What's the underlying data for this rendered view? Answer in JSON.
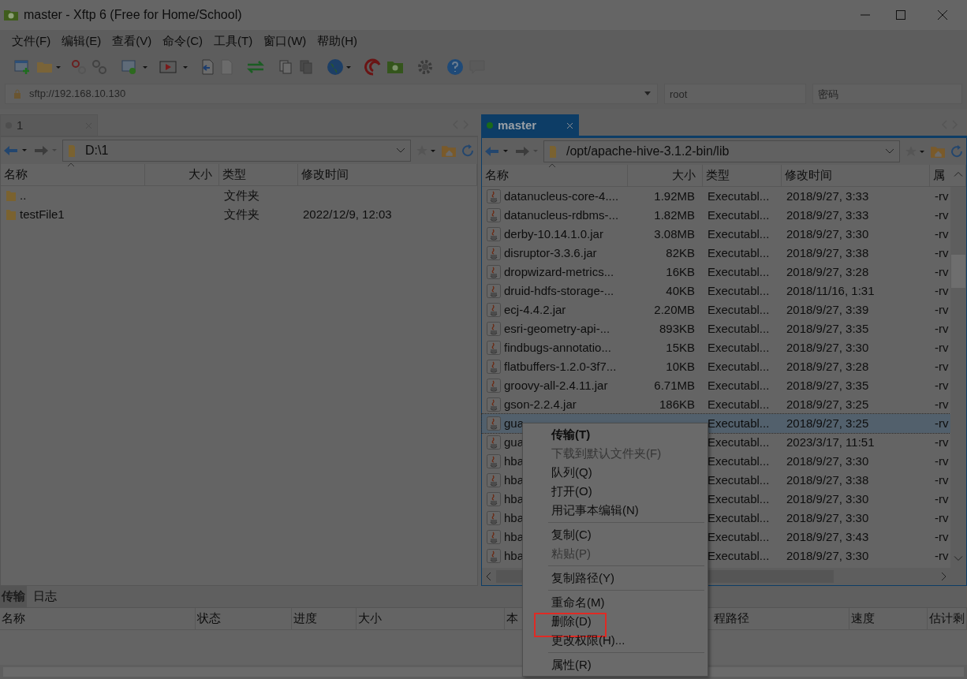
{
  "window": {
    "title": "master - Xftp 6 (Free for Home/School)"
  },
  "menu_bar": [
    "文件(F)",
    "编辑(E)",
    "查看(V)",
    "命令(C)",
    "工具(T)",
    "窗口(W)",
    "帮助(H)"
  ],
  "address_bar": {
    "host_placeholder": "sftp://192.168.10.130",
    "user_placeholder": "root",
    "password_placeholder": "密码"
  },
  "local_pane": {
    "tabs": [
      {
        "label": "1",
        "selected": false,
        "connected": false
      }
    ],
    "path": "D:\\1",
    "columns": [
      "名称",
      "大小",
      "类型",
      "修改时间"
    ],
    "rows": [
      {
        "kind": "folder",
        "name": "..",
        "type": "文件夹",
        "selected": false
      },
      {
        "kind": "folder",
        "name": "testFile1",
        "type": "文件夹",
        "modified": "2022/12/9, 12:03",
        "selected": false
      }
    ]
  },
  "remote_pane": {
    "tabs": [
      {
        "label": "master",
        "selected": true,
        "connected": true
      }
    ],
    "path": "/opt/apache-hive-3.1.2-bin/lib",
    "columns": [
      "名称",
      "大小",
      "类型",
      "修改时间",
      "属"
    ],
    "rows": [
      {
        "kind": "jar",
        "name": "datanucleus-core-4....",
        "size": "1.92MB",
        "type": "Executabl...",
        "modified": "2018/9/27, 3:33",
        "attr": "-rv",
        "selected": false
      },
      {
        "kind": "jar",
        "name": "datanucleus-rdbms-...",
        "size": "1.82MB",
        "type": "Executabl...",
        "modified": "2018/9/27, 3:33",
        "attr": "-rv",
        "selected": false
      },
      {
        "kind": "jar",
        "name": "derby-10.14.1.0.jar",
        "size": "3.08MB",
        "type": "Executabl...",
        "modified": "2018/9/27, 3:30",
        "attr": "-rv",
        "selected": false
      },
      {
        "kind": "jar",
        "name": "disruptor-3.3.6.jar",
        "size": "82KB",
        "type": "Executabl...",
        "modified": "2018/9/27, 3:38",
        "attr": "-rv",
        "selected": false
      },
      {
        "kind": "jar",
        "name": "dropwizard-metrics...",
        "size": "16KB",
        "type": "Executabl...",
        "modified": "2018/9/27, 3:28",
        "attr": "-rv",
        "selected": false
      },
      {
        "kind": "jar",
        "name": "druid-hdfs-storage-...",
        "size": "40KB",
        "type": "Executabl...",
        "modified": "2018/11/16, 1:31",
        "attr": "-rv",
        "selected": false
      },
      {
        "kind": "jar",
        "name": "ecj-4.4.2.jar",
        "size": "2.20MB",
        "type": "Executabl...",
        "modified": "2018/9/27, 3:39",
        "attr": "-rv",
        "selected": false
      },
      {
        "kind": "jar",
        "name": "esri-geometry-api-...",
        "size": "893KB",
        "type": "Executabl...",
        "modified": "2018/9/27, 3:35",
        "attr": "-rv",
        "selected": false
      },
      {
        "kind": "jar",
        "name": "findbugs-annotatio...",
        "size": "15KB",
        "type": "Executabl...",
        "modified": "2018/9/27, 3:30",
        "attr": "-rv",
        "selected": false
      },
      {
        "kind": "jar",
        "name": "flatbuffers-1.2.0-3f7...",
        "size": "10KB",
        "type": "Executabl...",
        "modified": "2018/9/27, 3:28",
        "attr": "-rv",
        "selected": false
      },
      {
        "kind": "jar",
        "name": "groovy-all-2.4.11.jar",
        "size": "6.71MB",
        "type": "Executabl...",
        "modified": "2018/9/27, 3:35",
        "attr": "-rv",
        "selected": false
      },
      {
        "kind": "jar",
        "name": "gson-2.2.4.jar",
        "size": "186KB",
        "type": "Executabl...",
        "modified": "2018/9/27, 3:25",
        "attr": "-rv",
        "selected": false
      },
      {
        "kind": "jar",
        "name": "gua",
        "type": "Executabl...",
        "modified": "2018/9/27, 3:25",
        "attr": "-rv",
        "selected": true
      },
      {
        "kind": "jar",
        "name": "gua",
        "type": "Executabl...",
        "modified": "2023/3/17, 11:51",
        "attr": "-rv",
        "selected": false
      },
      {
        "kind": "jar",
        "name": "hba",
        "type": "Executabl...",
        "modified": "2018/9/27, 3:30",
        "attr": "-rv",
        "selected": false
      },
      {
        "kind": "jar",
        "name": "hba",
        "type": "Executabl...",
        "modified": "2018/9/27, 3:38",
        "attr": "-rv",
        "selected": false
      },
      {
        "kind": "jar",
        "name": "hba",
        "type": "Executabl...",
        "modified": "2018/9/27, 3:30",
        "attr": "-rv",
        "selected": false
      },
      {
        "kind": "jar",
        "name": "hba",
        "type": "Executabl...",
        "modified": "2018/9/27, 3:30",
        "attr": "-rv",
        "selected": false
      },
      {
        "kind": "jar",
        "name": "hba",
        "type": "Executabl...",
        "modified": "2018/9/27, 3:43",
        "attr": "-rv",
        "selected": false
      },
      {
        "kind": "jar",
        "name": "hba",
        "type": "Executabl...",
        "modified": "2018/9/27, 3:30",
        "attr": "-rv",
        "selected": false
      }
    ]
  },
  "transfer_panel": {
    "tabs": [
      {
        "label": "传输",
        "selected": true
      },
      {
        "label": "日志",
        "selected": false
      }
    ],
    "columns": [
      "名称",
      "状态",
      "进度",
      "大小",
      "本",
      "程路径",
      "速度",
      "估计剩"
    ]
  },
  "context_menu": {
    "items": [
      {
        "kind": "item",
        "label": "传输(T)",
        "bold": true,
        "disabled": false,
        "highlighted": false
      },
      {
        "kind": "item",
        "label": "下载到默认文件夹(F)",
        "bold": false,
        "disabled": true,
        "highlighted": false
      },
      {
        "kind": "item",
        "label": "队列(Q)",
        "bold": false,
        "disabled": false,
        "highlighted": false
      },
      {
        "kind": "item",
        "label": "打开(O)",
        "bold": false,
        "disabled": false,
        "highlighted": false
      },
      {
        "kind": "item",
        "label": "用记事本编辑(N)",
        "bold": false,
        "disabled": false,
        "highlighted": false
      },
      {
        "kind": "separator"
      },
      {
        "kind": "item",
        "label": "复制(C)",
        "bold": false,
        "disabled": false,
        "highlighted": false
      },
      {
        "kind": "item",
        "label": "粘贴(P)",
        "bold": false,
        "disabled": true,
        "highlighted": false
      },
      {
        "kind": "separator"
      },
      {
        "kind": "item",
        "label": "复制路径(Y)",
        "bold": false,
        "disabled": false,
        "highlighted": false
      },
      {
        "kind": "separator"
      },
      {
        "kind": "item",
        "label": "重命名(M)",
        "bold": false,
        "disabled": false,
        "highlighted": false
      },
      {
        "kind": "item",
        "label": "删除(D)",
        "bold": false,
        "disabled": false,
        "highlighted": true
      },
      {
        "kind": "item",
        "label": "更改权限(H)...",
        "bold": false,
        "disabled": false,
        "highlighted": false
      },
      {
        "kind": "separator"
      },
      {
        "kind": "item",
        "label": "属性(R)",
        "bold": false,
        "disabled": false,
        "highlighted": false
      }
    ]
  }
}
